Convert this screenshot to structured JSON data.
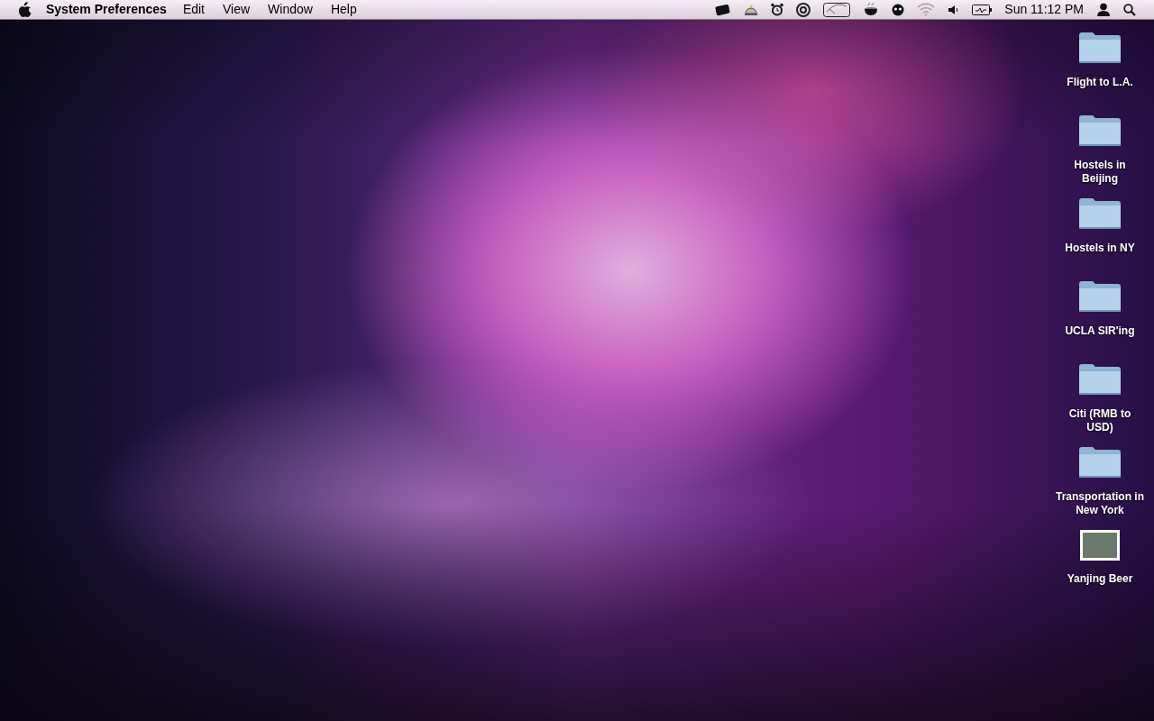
{
  "menu_bar": {
    "app_name": "System Preferences",
    "menus": [
      "Edit",
      "View",
      "Window",
      "Help"
    ],
    "clock": "Sun 11:12 PM"
  },
  "desktop_items": [
    {
      "kind": "folder",
      "label": "Flight to L.A."
    },
    {
      "kind": "folder",
      "label": "Hostels in Beijing"
    },
    {
      "kind": "folder",
      "label": "Hostels in NY"
    },
    {
      "kind": "folder",
      "label": "UCLA SIR'ing"
    },
    {
      "kind": "folder",
      "label": "Citi (RMB to USD)"
    },
    {
      "kind": "folder",
      "label": "Transportation in New York"
    },
    {
      "kind": "image",
      "label": "Yanjing Beer"
    }
  ]
}
